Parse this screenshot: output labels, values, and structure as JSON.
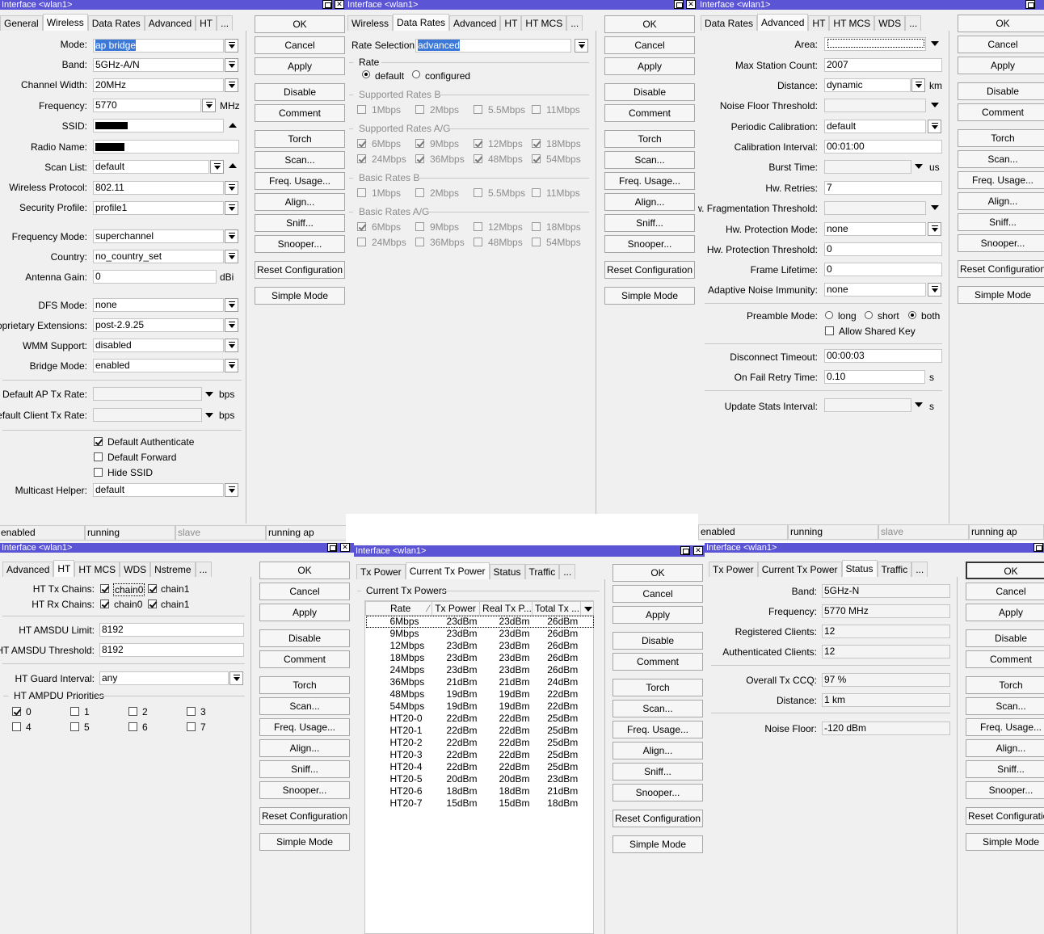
{
  "window_title": "Interface <wlan1>",
  "buttons": {
    "ok": "OK",
    "cancel": "Cancel",
    "apply": "Apply",
    "disable": "Disable",
    "comment": "Comment",
    "torch": "Torch",
    "scan": "Scan...",
    "freq_usage": "Freq. Usage...",
    "align": "Align...",
    "sniff": "Sniff...",
    "snooper": "Snooper...",
    "reset": "Reset Configuration",
    "simple": "Simple Mode"
  },
  "w1": {
    "tabs": [
      "General",
      "Wireless",
      "Data Rates",
      "Advanced",
      "HT",
      "..."
    ],
    "labels": {
      "mode": "Mode:",
      "band": "Band:",
      "channel_width": "Channel Width:",
      "frequency": "Frequency:",
      "ssid": "SSID:",
      "radio_name": "Radio Name:",
      "scan_list": "Scan List:",
      "wireless_protocol": "Wireless Protocol:",
      "security_profile": "Security Profile:",
      "frequency_mode": "Frequency Mode:",
      "country": "Country:",
      "antenna_gain": "Antenna Gain:",
      "dfs_mode": "DFS Mode:",
      "proprietary_ext": "Proprietary Extensions:",
      "wmm_support": "WMM Support:",
      "bridge_mode": "Bridge Mode:",
      "default_ap_tx": "Default AP Tx Rate:",
      "default_client_tx": "Default Client Tx Rate:",
      "multicast_helper": "Multicast Helper:"
    },
    "values": {
      "mode": "ap bridge",
      "band": "5GHz-A/N",
      "channel_width": "20MHz",
      "frequency": "5770",
      "scan_list": "default",
      "wireless_protocol": "802.11",
      "security_profile": "profile1",
      "frequency_mode": "superchannel",
      "country": "no_country_set",
      "antenna_gain": "0",
      "dfs_mode": "none",
      "proprietary_ext": "post-2.9.25",
      "wmm_support": "disabled",
      "bridge_mode": "enabled",
      "multicast_helper": "default"
    },
    "units": {
      "mhz": "MHz",
      "dbi": "dBi",
      "bps": "bps"
    },
    "checks": {
      "default_authenticate": "Default Authenticate",
      "default_forward": "Default Forward",
      "hide_ssid": "Hide SSID"
    },
    "status": [
      "enabled",
      "running",
      "slave",
      "running ap"
    ]
  },
  "w2": {
    "tabs": [
      "Wireless",
      "Data Rates",
      "Advanced",
      "HT",
      "HT MCS",
      "..."
    ],
    "rate_selection_label": "Rate Selection:",
    "rate_selection": "advanced",
    "rate_group": "Rate",
    "rate_default": "default",
    "rate_configured": "configured",
    "supported_b": "Supported Rates B",
    "supported_ag": "Supported Rates A/G",
    "basic_b": "Basic Rates B",
    "basic_ag": "Basic Rates A/G",
    "rates_b": [
      "1Mbps",
      "2Mbps",
      "5.5Mbps",
      "11Mbps"
    ],
    "rates_ag": [
      "6Mbps",
      "9Mbps",
      "12Mbps",
      "18Mbps",
      "24Mbps",
      "36Mbps",
      "48Mbps",
      "54Mbps"
    ]
  },
  "w3": {
    "tabs": [
      "Data Rates",
      "Advanced",
      "HT",
      "HT MCS",
      "WDS",
      "..."
    ],
    "labels": {
      "area": "Area:",
      "max_station": "Max Station Count:",
      "distance": "Distance:",
      "noise_floor": "Noise Floor Threshold:",
      "periodic_cal": "Periodic Calibration:",
      "cal_interval": "Calibration Interval:",
      "burst_time": "Burst Time:",
      "hw_retries": "Hw. Retries:",
      "hw_frag": "Hw. Fragmentation Threshold:",
      "hw_prot_mode": "Hw. Protection Mode:",
      "hw_prot_thr": "Hw. Protection Threshold:",
      "frame_lifetime": "Frame Lifetime:",
      "adaptive_noise": "Adaptive Noise Immunity:",
      "preamble": "Preamble Mode:",
      "disconnect": "Disconnect Timeout:",
      "on_fail": "On Fail Retry Time:",
      "update_stats": "Update Stats Interval:"
    },
    "values": {
      "max_station": "2007",
      "distance": "dynamic",
      "periodic_cal": "default",
      "cal_interval": "00:01:00",
      "hw_retries": "7",
      "hw_prot_mode": "none",
      "hw_prot_thr": "0",
      "frame_lifetime": "0",
      "adaptive_noise": "none",
      "disconnect": "00:00:03",
      "on_fail": "0.10"
    },
    "units": {
      "km": "km",
      "us": "us",
      "s": "s"
    },
    "preamble_opts": [
      "long",
      "short",
      "both"
    ],
    "allow_shared_key": "Allow Shared Key",
    "status": [
      "enabled",
      "running",
      "slave",
      "running ap"
    ]
  },
  "w4": {
    "tabs": [
      "Advanced",
      "HT",
      "HT MCS",
      "WDS",
      "Nstreme",
      "..."
    ],
    "labels": {
      "tx_chains": "HT Tx Chains:",
      "rx_chains": "HT Rx Chains:",
      "amsdu_limit": "HT AMSDU Limit:",
      "amsdu_thr": "HT AMSDU Threshold:",
      "guard": "HT Guard Interval:"
    },
    "chains": [
      "chain0",
      "chain1"
    ],
    "values": {
      "amsdu_limit": "8192",
      "amsdu_thr": "8192",
      "guard": "any"
    },
    "ampdu_group": "HT AMPDU Priorities",
    "priorities": [
      "0",
      "1",
      "2",
      "3",
      "4",
      "5",
      "6",
      "7"
    ]
  },
  "w5": {
    "tabs": [
      "Tx Power",
      "Current Tx Power",
      "Status",
      "Traffic",
      "..."
    ],
    "group": "Current Tx Powers",
    "columns": [
      "Rate",
      "Tx Power",
      "Real Tx P...",
      "Total Tx ..."
    ],
    "rows": [
      [
        "6Mbps",
        "23dBm",
        "23dBm",
        "26dBm"
      ],
      [
        "9Mbps",
        "23dBm",
        "23dBm",
        "26dBm"
      ],
      [
        "12Mbps",
        "23dBm",
        "23dBm",
        "26dBm"
      ],
      [
        "18Mbps",
        "23dBm",
        "23dBm",
        "26dBm"
      ],
      [
        "24Mbps",
        "23dBm",
        "23dBm",
        "26dBm"
      ],
      [
        "36Mbps",
        "21dBm",
        "21dBm",
        "24dBm"
      ],
      [
        "48Mbps",
        "19dBm",
        "19dBm",
        "22dBm"
      ],
      [
        "54Mbps",
        "19dBm",
        "19dBm",
        "22dBm"
      ],
      [
        "HT20-0",
        "22dBm",
        "22dBm",
        "25dBm"
      ],
      [
        "HT20-1",
        "22dBm",
        "22dBm",
        "25dBm"
      ],
      [
        "HT20-2",
        "22dBm",
        "22dBm",
        "25dBm"
      ],
      [
        "HT20-3",
        "22dBm",
        "22dBm",
        "25dBm"
      ],
      [
        "HT20-4",
        "22dBm",
        "22dBm",
        "25dBm"
      ],
      [
        "HT20-5",
        "20dBm",
        "20dBm",
        "23dBm"
      ],
      [
        "HT20-6",
        "18dBm",
        "18dBm",
        "21dBm"
      ],
      [
        "HT20-7",
        "15dBm",
        "15dBm",
        "18dBm"
      ]
    ]
  },
  "w6": {
    "tabs": [
      "Tx Power",
      "Current Tx Power",
      "Status",
      "Traffic",
      "..."
    ],
    "labels": {
      "band": "Band:",
      "frequency": "Frequency:",
      "registered": "Registered Clients:",
      "authenticated": "Authenticated Clients:",
      "ccq": "Overall Tx CCQ:",
      "distance": "Distance:",
      "noise": "Noise Floor:"
    },
    "values": {
      "band": "5GHz-N",
      "frequency": "5770 MHz",
      "registered": "12",
      "authenticated": "12",
      "ccq": "97 %",
      "distance": "1 km",
      "noise": "-120 dBm"
    }
  }
}
